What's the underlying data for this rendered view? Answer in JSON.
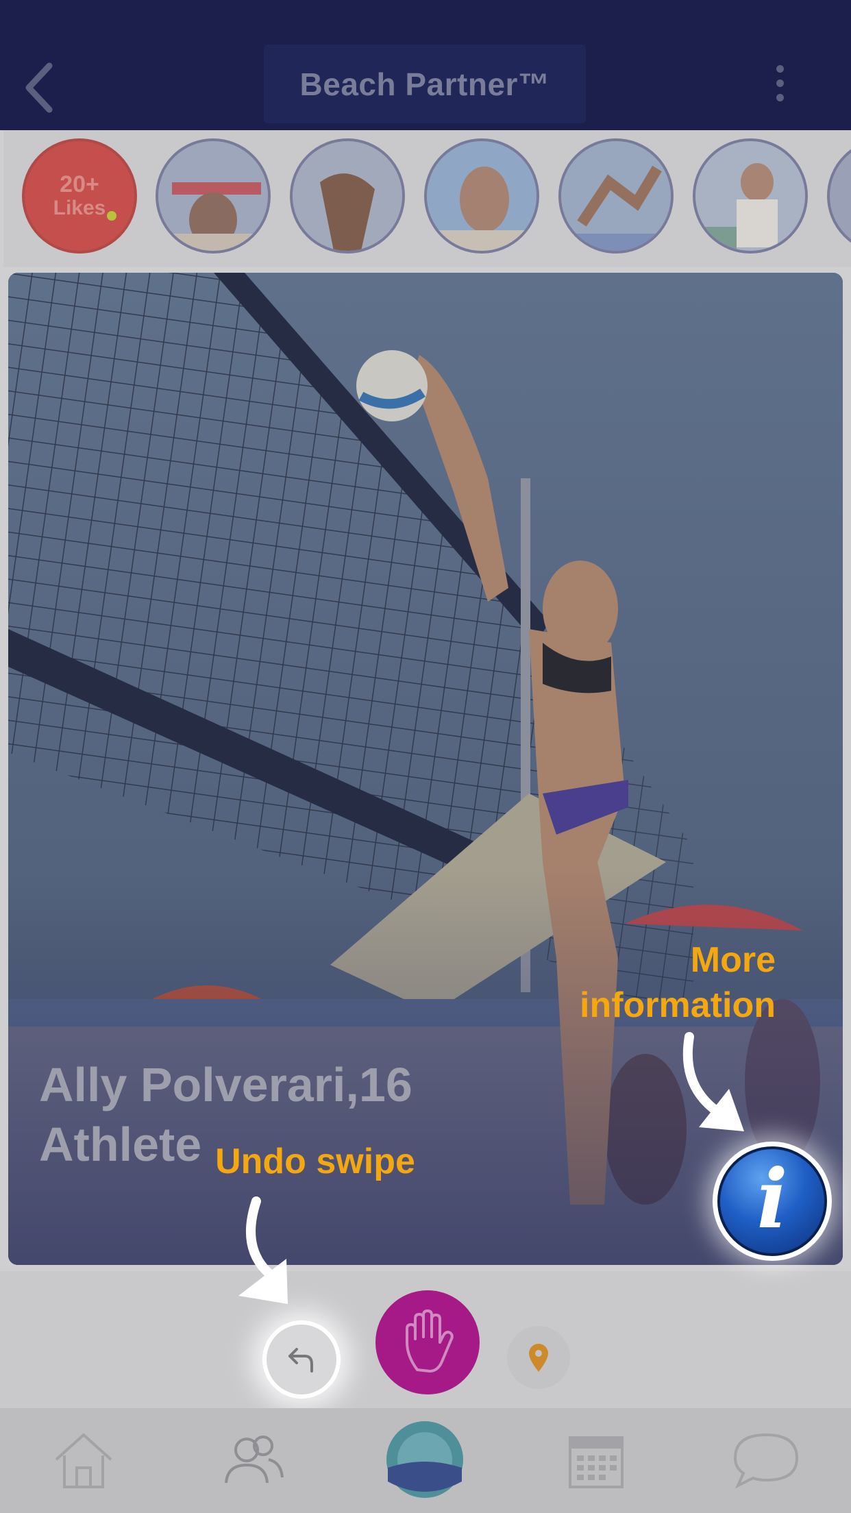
{
  "header": {
    "title": "Beach Partner™",
    "back_icon": "chevron-left-icon",
    "menu_icon": "more-vertical-icon"
  },
  "stories": {
    "likes_count": "20+",
    "likes_label": "Likes",
    "items": [
      "profile-story-1",
      "profile-story-2",
      "profile-story-3",
      "profile-story-4",
      "profile-story-5"
    ]
  },
  "card": {
    "name_age": "Ally Polverari,16",
    "role": "Athlete"
  },
  "actions": {
    "undo_icon": "undo-icon",
    "hifive_icon": "hand-icon",
    "location_icon": "location-pin-icon"
  },
  "tabbar": {
    "items": [
      "home-icon",
      "people-icon",
      "beach-partner-logo-icon",
      "calendar-icon",
      "chat-icon"
    ]
  },
  "coach": {
    "more_info": "More information",
    "more_info_line1": "More",
    "more_info_line2": "information",
    "undo": "Undo swipe"
  },
  "colors": {
    "header_bg": "#1c1f4b",
    "accent_orange": "#f5a70f",
    "hifive_magenta": "#a51a86",
    "info_blue": "#1f5fc5"
  }
}
